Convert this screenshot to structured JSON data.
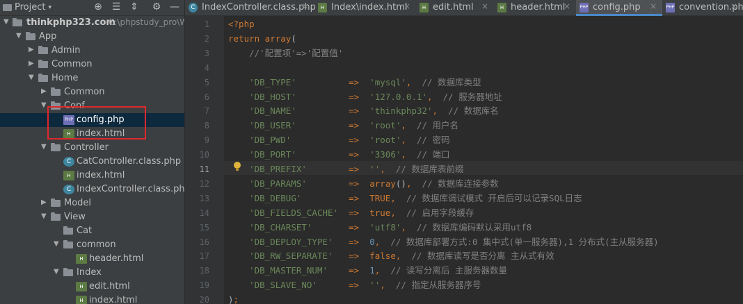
{
  "project_panel": {
    "title": "Project",
    "header_icons": [
      "target-icon",
      "align-icon",
      "collapse-icon",
      "gear-icon",
      "hide-icon"
    ],
    "root_name": "thinkphp323.com",
    "root_path": "C:\\phpstudy_pro\\W",
    "tree": [
      {
        "label": "App",
        "type": "folder",
        "expanded": true,
        "depth": 1
      },
      {
        "label": "Admin",
        "type": "folder",
        "expanded": false,
        "depth": 2
      },
      {
        "label": "Common",
        "type": "folder",
        "expanded": false,
        "depth": 2
      },
      {
        "label": "Home",
        "type": "folder",
        "expanded": true,
        "depth": 2
      },
      {
        "label": "Common",
        "type": "folder",
        "expanded": false,
        "depth": 3
      },
      {
        "label": "Conf",
        "type": "folder",
        "expanded": true,
        "depth": 3
      },
      {
        "label": "config.php",
        "type": "php",
        "depth": 4,
        "selected": true
      },
      {
        "label": "index.html",
        "type": "html",
        "depth": 4
      },
      {
        "label": "Controller",
        "type": "folder",
        "expanded": true,
        "depth": 3
      },
      {
        "label": "CatController.class.php",
        "type": "class",
        "depth": 4
      },
      {
        "label": "index.html",
        "type": "html",
        "depth": 4
      },
      {
        "label": "IndexController.class.php",
        "type": "class",
        "depth": 4
      },
      {
        "label": "Model",
        "type": "folder",
        "expanded": false,
        "depth": 3
      },
      {
        "label": "View",
        "type": "folder",
        "expanded": true,
        "depth": 3
      },
      {
        "label": "Cat",
        "type": "folder",
        "expanded": null,
        "depth": 4
      },
      {
        "label": "common",
        "type": "folder",
        "expanded": true,
        "depth": 4
      },
      {
        "label": "header.html",
        "type": "html",
        "depth": 5
      },
      {
        "label": "Index",
        "type": "folder",
        "expanded": true,
        "depth": 4
      },
      {
        "label": "edit.html",
        "type": "html",
        "depth": 5
      },
      {
        "label": "index.html",
        "type": "html",
        "depth": 5
      }
    ]
  },
  "tabs": [
    {
      "label": "IndexController.class.php",
      "icon": "class"
    },
    {
      "label": "Index\\index.html",
      "icon": "html"
    },
    {
      "label": "edit.html",
      "icon": "html"
    },
    {
      "label": "header.html",
      "icon": "html"
    },
    {
      "label": "config.php",
      "icon": "php",
      "active": true
    },
    {
      "label": "convention.php",
      "icon": "php"
    }
  ],
  "editor": {
    "current_line": 11,
    "lines": [
      {
        "n": "1",
        "t": "<?php"
      },
      {
        "n": "2",
        "t": "return array("
      },
      {
        "n": "3",
        "t": "    //'配置项'=>'配置值'"
      },
      {
        "n": "4",
        "t": ""
      },
      {
        "n": "5",
        "k": "'DB_TYPE'",
        "v": "'mysql',",
        "c": "// 数据库类型"
      },
      {
        "n": "6",
        "k": "'DB_HOST'",
        "v": "'127.0.0.1',",
        "c": "// 服务器地址"
      },
      {
        "n": "7",
        "k": "'DB_NAME'",
        "v": "'thinkphp32',",
        "c": "// 数据库名"
      },
      {
        "n": "8",
        "k": "'DB_USER'",
        "v": "'root',",
        "c": "// 用户名"
      },
      {
        "n": "9",
        "k": "'DB_PWD'",
        "v": "'root',",
        "c": "// 密码"
      },
      {
        "n": "10",
        "k": "'DB_PORT'",
        "v": "'3306',",
        "c": "// 端口"
      },
      {
        "n": "11",
        "k": "'DB_PREFIX'",
        "v": "'',",
        "c": "// 数据库表前缀"
      },
      {
        "n": "12",
        "k": "'DB_PARAMS'",
        "v": "array(),",
        "c": "// 数据库连接参数"
      },
      {
        "n": "13",
        "k": "'DB_DEBUG'",
        "v": "TRUE,",
        "c": "// 数据库调试模式 开启后可以记录SQL日志"
      },
      {
        "n": "14",
        "k": "'DB_FIELDS_CACHE'",
        "v": "true,",
        "c": "// 启用字段缓存"
      },
      {
        "n": "15",
        "k": "'DB_CHARSET'",
        "v": "'utf8',",
        "c": "// 数据库编码默认采用utf8"
      },
      {
        "n": "16",
        "k": "'DB_DEPLOY_TYPE'",
        "v": "0,",
        "c": "// 数据库部署方式:0 集中式(单一服务器),1 分布式(主从服务器)"
      },
      {
        "n": "17",
        "k": "'DB_RW_SEPARATE'",
        "v": "false,",
        "c": "// 数据库读写是否分离 主从式有效"
      },
      {
        "n": "18",
        "k": "'DB_MASTER_NUM'",
        "v": "1,",
        "c": "// 读写分离后 主服务器数量"
      },
      {
        "n": "19",
        "k": "'DB_SLAVE_NO'",
        "v": "'',",
        "c": "// 指定从服务器序号"
      },
      {
        "n": "20",
        "t": ");"
      }
    ]
  }
}
